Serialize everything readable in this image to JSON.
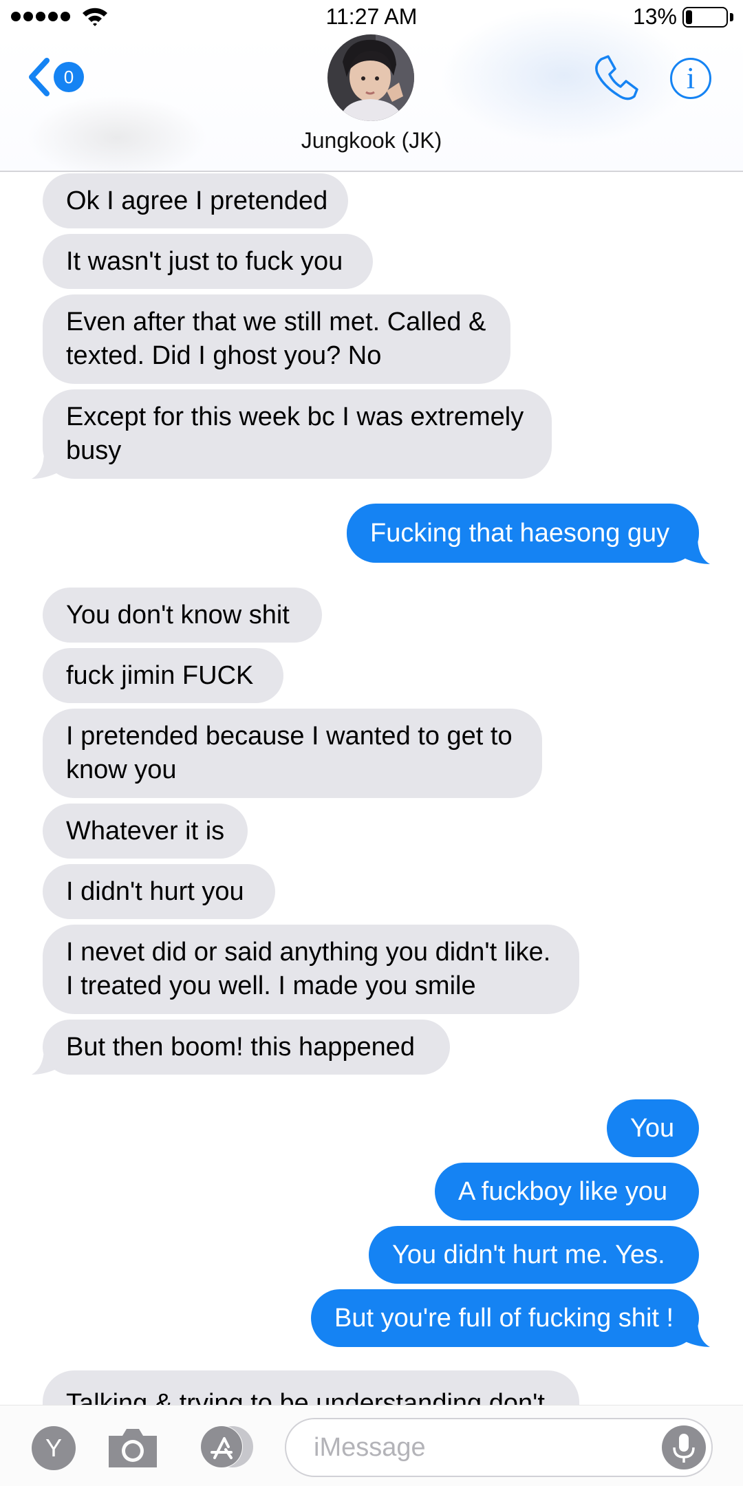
{
  "status_bar": {
    "time": "11:27 AM",
    "battery_percent": "13%",
    "battery_level": 0.13,
    "signal_bars": 5
  },
  "header": {
    "back_badge": "0",
    "contact_name": "Jungkook  (JK)",
    "icons": [
      "chevron-left-icon",
      "phone-icon",
      "info-icon"
    ]
  },
  "messages": [
    {
      "side": "in",
      "text": "Ok I agree I pretended"
    },
    {
      "side": "in",
      "text": "It wasn't just to fuck you"
    },
    {
      "side": "in",
      "lines": [
        "Even after that we still met. Called &",
        "texted. Did I ghost you? No"
      ]
    },
    {
      "side": "in",
      "lines": [
        "Except for this week bc I was extremely",
        "busy"
      ]
    },
    {
      "side": "out",
      "text": "Fucking that haesong guy"
    },
    {
      "side": "in",
      "text": "You don't know shit"
    },
    {
      "side": "in",
      "text": "fuck jimin FUCK"
    },
    {
      "side": "in",
      "lines": [
        "I pretended because I wanted to get to",
        "know you"
      ]
    },
    {
      "side": "in",
      "text": "Whatever it is"
    },
    {
      "side": "in",
      "text": "I didn't hurt you"
    },
    {
      "side": "in",
      "lines": [
        "I nevet did or said anything you didn't like.",
        "I treated you well. I made you smile"
      ]
    },
    {
      "side": "in",
      "text": "But then boom! this happened"
    },
    {
      "side": "out",
      "text": "You"
    },
    {
      "side": "out",
      "text": "A fuckboy like you"
    },
    {
      "side": "out",
      "text": "You didn't hurt me. Yes."
    },
    {
      "side": "out",
      "text": "But you're full of fucking shit !"
    },
    {
      "side": "in",
      "text": "Talking & trying to be understanding don't"
    }
  ],
  "compose": {
    "apps_label": "Y",
    "placeholder": "iMessage",
    "icons": [
      "camera-icon",
      "app-store-icon",
      "microphone-icon"
    ]
  },
  "colors": {
    "accent": "#1583f3",
    "incoming_bubble": "#e5e5ea",
    "outgoing_bubble": "#1583f3"
  }
}
